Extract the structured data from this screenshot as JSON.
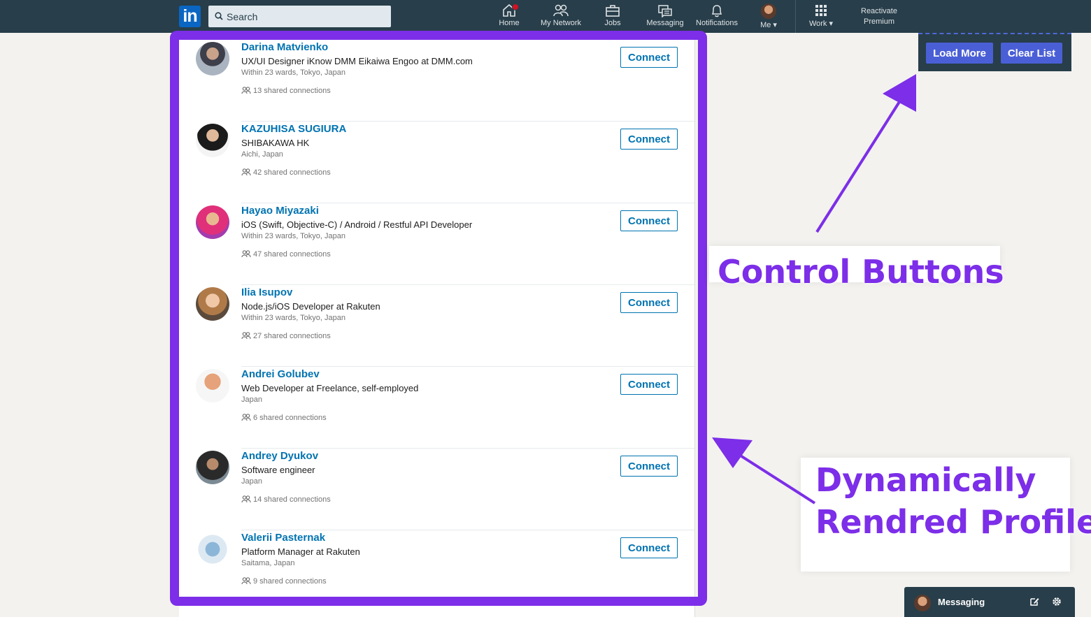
{
  "nav": {
    "logo": "in",
    "search_placeholder": "Search",
    "items": [
      {
        "label": "Home",
        "icon": "home-icon"
      },
      {
        "label": "My Network",
        "icon": "people-icon"
      },
      {
        "label": "Jobs",
        "icon": "briefcase-icon"
      },
      {
        "label": "Messaging",
        "icon": "chat-icon"
      },
      {
        "label": "Notifications",
        "icon": "bell-icon"
      },
      {
        "label": "Me ▾",
        "icon": "avatar"
      },
      {
        "label": "Work ▾",
        "icon": "grid-icon"
      }
    ],
    "premium_line1": "Reactivate",
    "premium_line2": "Premium"
  },
  "controls": {
    "load_more": "Load More",
    "clear_list": "Clear List"
  },
  "profiles": [
    {
      "name": "Darina Matvienko",
      "headline": "UX/UI Designer iKnow DMM Eikaiwa Engoo at DMM.com",
      "location": "Within 23 wards, Tokyo, Japan",
      "shared": "13 shared connections",
      "action": "Connect"
    },
    {
      "name": "KAZUHISA SUGIURA",
      "headline": "SHIBAKAWA HK",
      "location": "Aichi, Japan",
      "shared": "42 shared connections",
      "action": "Connect"
    },
    {
      "name": "Hayao Miyazaki",
      "headline": "iOS (Swift, Objective-C) / Android / Restful API Developer",
      "location": "Within 23 wards, Tokyo, Japan",
      "shared": "47 shared connections",
      "action": "Connect"
    },
    {
      "name": "Ilia Isupov",
      "headline": "Node.js/iOS Developer at Rakuten",
      "location": "Within 23 wards, Tokyo, Japan",
      "shared": "27 shared connections",
      "action": "Connect"
    },
    {
      "name": "Andrei Golubev",
      "headline": "Web Developer at Freelance, self-employed",
      "location": "Japan",
      "shared": "6 shared connections",
      "action": "Connect"
    },
    {
      "name": "Andrey Dyukov",
      "headline": "Software engineer",
      "location": "Japan",
      "shared": "14 shared connections",
      "action": "Connect"
    },
    {
      "name": "Valerii Pasternak",
      "headline": "Platform Manager at Rakuten",
      "location": "Saitama, Japan",
      "shared": "9 shared connections",
      "action": "Connect"
    }
  ],
  "annotations": {
    "control_buttons": "Control Buttons",
    "dynamic_line1": "Dynamically",
    "dynamic_line2": "Rendred Profiles"
  },
  "messaging_dock": {
    "label": "Messaging"
  },
  "colors": {
    "nav_bg": "#283e4a",
    "link_blue": "#0073b1",
    "annotation_purple": "#7c2ee8",
    "control_button": "#4a5fd6"
  }
}
